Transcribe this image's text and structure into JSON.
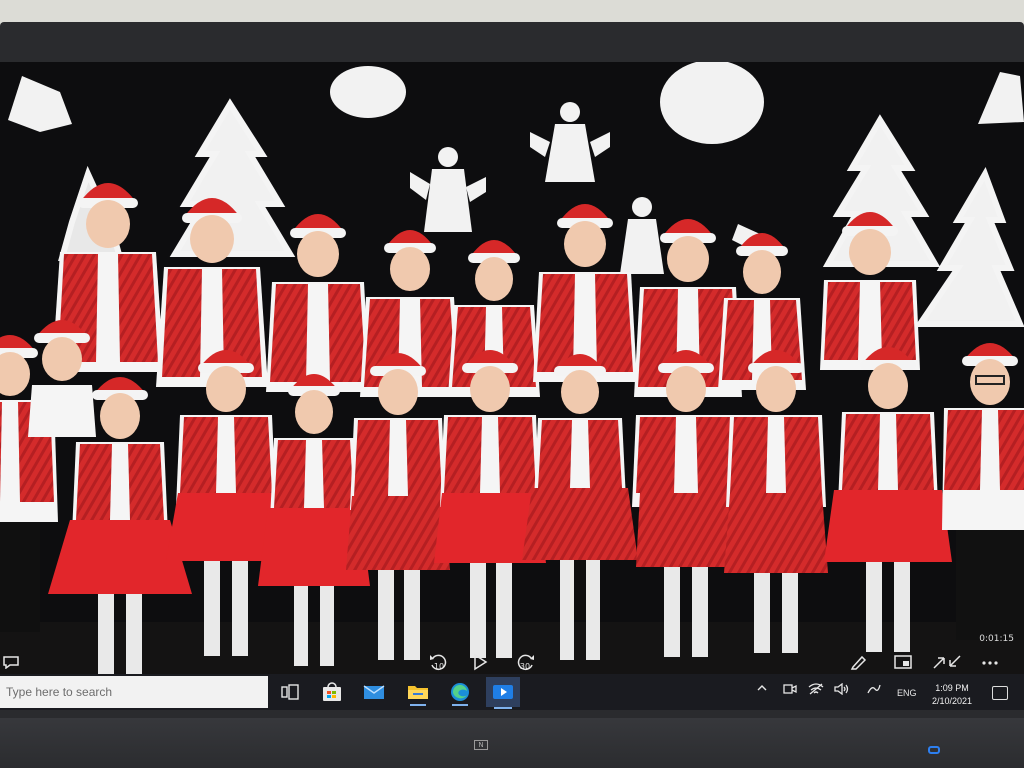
{
  "video": {
    "elapsed": "0:01:15",
    "skip_back_seconds": "10",
    "skip_forward_seconds": "30"
  },
  "taskbar": {
    "search_placeholder": "Type here to search",
    "apps": [
      {
        "name": "task-view-icon"
      },
      {
        "name": "store-icon"
      },
      {
        "name": "mail-icon"
      },
      {
        "name": "file-explorer-icon"
      },
      {
        "name": "edge-icon"
      },
      {
        "name": "movies-tv-icon",
        "active": true
      }
    ],
    "tray": {
      "language": "ENG",
      "time": "1:09 PM",
      "date": "2/10/2021"
    }
  },
  "colors": {
    "taskbar": "#1a1b20",
    "accent": "#0078d7",
    "costume_red": "#d12a2a"
  }
}
